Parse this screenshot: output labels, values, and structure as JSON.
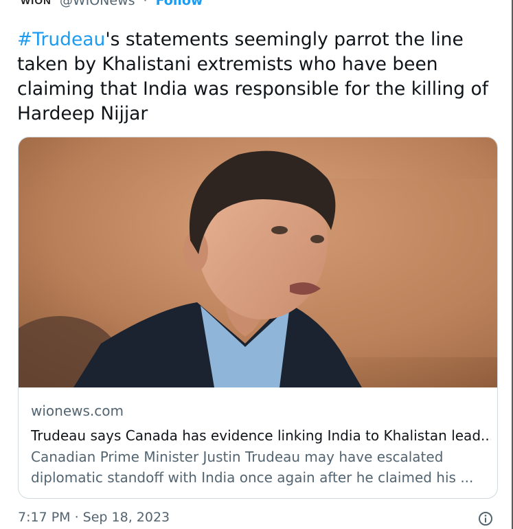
{
  "header": {
    "logo_text": "WION",
    "handle": "@WIONews",
    "separator": "·",
    "follow_label": "Follow"
  },
  "tweet": {
    "hashtag": "#Trudeau",
    "text": "'s statements seemingly parrot the line taken by Khalistani extremists who have been claiming that India was responsible for the killing of Hardeep Nijjar"
  },
  "card": {
    "image_subject": "photo-of-speaker",
    "domain": "wionews.com",
    "title": "Trudeau says Canada has evidence linking India to Khalistan lead...",
    "description_line1": "Canadian Prime Minister Justin Trudeau may have escalated",
    "description_line2": "diplomatic standoff with India once again after he claimed his ..."
  },
  "footer": {
    "timestamp": "7:17 PM · Sep 18, 2023",
    "info_icon": "info-icon"
  },
  "colors": {
    "accent": "#1d9bf0",
    "secondary_text": "#536471",
    "primary_text": "#0f1419",
    "card_border": "#cfd9de"
  }
}
